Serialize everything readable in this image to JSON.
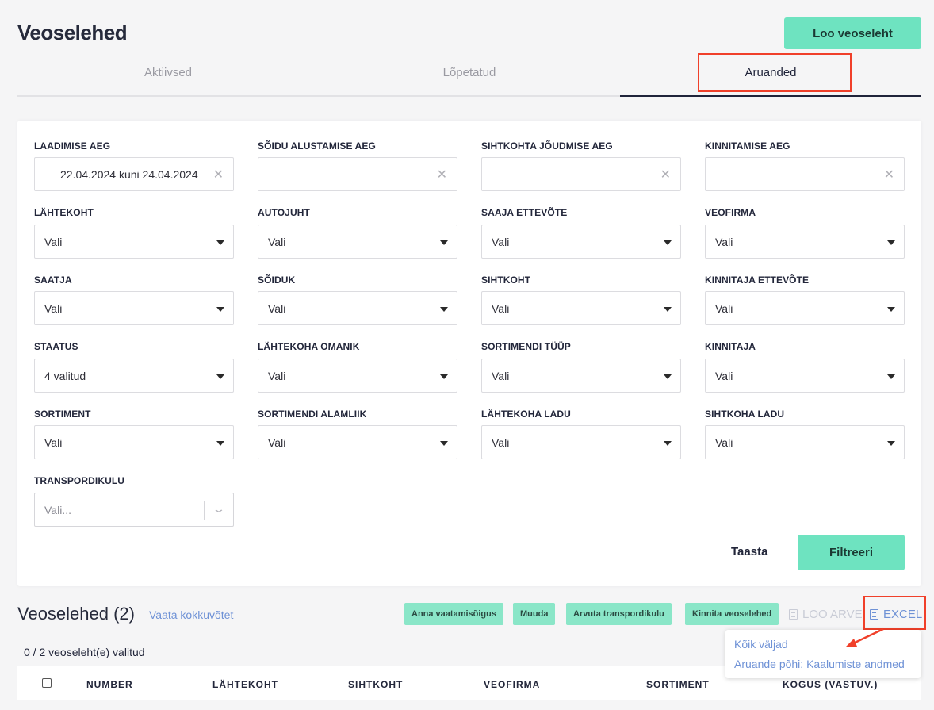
{
  "header": {
    "title": "Veoselehed",
    "create_button": "Loo veoseleht"
  },
  "tabs": [
    {
      "label": "Aktiivsed",
      "active": false
    },
    {
      "label": "Lõpetatud",
      "active": false
    },
    {
      "label": "Aruanded",
      "active": true
    }
  ],
  "filters": {
    "row1": [
      {
        "label": "LAADIMISE AEG",
        "value": "22.04.2024 kuni 24.04.2024"
      },
      {
        "label": "SÕIDU ALUSTAMISE AEG",
        "value": ""
      },
      {
        "label": "SIHTKOHTA JÕUDMISE AEG",
        "value": ""
      },
      {
        "label": "KINNITAMISE AEG",
        "value": ""
      }
    ],
    "row2": [
      {
        "label": "LÄHTEKOHT",
        "value": "Vali"
      },
      {
        "label": "AUTOJUHT",
        "value": "Vali"
      },
      {
        "label": "SAAJA ETTEVÕTE",
        "value": "Vali"
      },
      {
        "label": "VEOFIRMA",
        "value": "Vali"
      }
    ],
    "row3": [
      {
        "label": "SAATJA",
        "value": "Vali"
      },
      {
        "label": "SÕIDUK",
        "value": "Vali"
      },
      {
        "label": "SIHTKOHT",
        "value": "Vali"
      },
      {
        "label": "KINNITAJA ETTEVÕTE",
        "value": "Vali"
      }
    ],
    "row4": [
      {
        "label": "STAATUS",
        "value": "4 valitud"
      },
      {
        "label": "LÄHTEKOHA OMANIK",
        "value": "Vali"
      },
      {
        "label": "SORTIMENDI TÜÜP",
        "value": "Vali"
      },
      {
        "label": "KINNITAJA",
        "value": "Vali"
      }
    ],
    "row5": [
      {
        "label": "SORTIMENT",
        "value": "Vali"
      },
      {
        "label": "SORTIMENDI ALAMLIIK",
        "value": "Vali"
      },
      {
        "label": "LÄHTEKOHA LADU",
        "value": "Vali"
      },
      {
        "label": "SIHTKOHA LADU",
        "value": "Vali"
      }
    ],
    "row6": [
      {
        "label": "TRANSPORDIKULU",
        "placeholder": "Vali..."
      }
    ],
    "reset_label": "Taasta",
    "apply_label": "Filtreeri"
  },
  "list": {
    "title": "Veoselehed (2)",
    "summary_link": "Vaata kokkuvõtet",
    "actions": [
      "Anna vaatamisõigus",
      "Muuda",
      "Arvuta transpordikulu",
      "Kinnita veoselehed"
    ],
    "invoice_label": "LOO ARVE",
    "excel_label": "EXCEL",
    "selected_text": "0 / 2 veoseleht(e) valitud",
    "columns": [
      "NUMBER",
      "LÄHTEKOHT",
      "SIHTKOHT",
      "VEOFIRMA",
      "SORTIMENT",
      "KOGUS (VASTUV.)"
    ]
  },
  "excel_menu": [
    "Kõik väljad",
    "Aruande põhi: Kaalumiste andmed"
  ],
  "colors": {
    "accent": "#6ee3c0",
    "link": "#6f92d6",
    "highlight": "#f0402a",
    "dark": "#20243a"
  }
}
